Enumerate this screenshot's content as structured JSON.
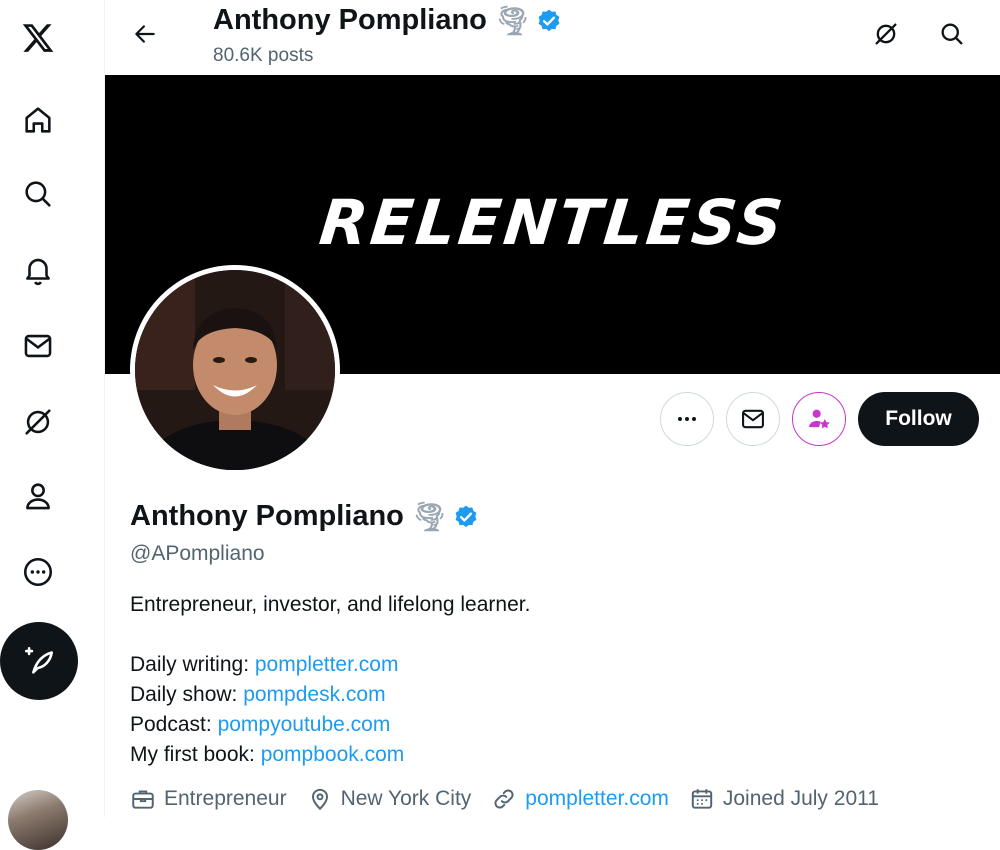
{
  "header": {
    "name": "Anthony Pompliano",
    "name_emoji": "🌪",
    "posts": "80.6K posts"
  },
  "banner": {
    "text": "RELENTLESS"
  },
  "profile": {
    "name": "Anthony Pompliano",
    "name_emoji": "🌪",
    "handle": "@APompliano",
    "bio_line1": "Entrepreneur, investor, and lifelong learner.",
    "bio_links": [
      {
        "label": "Daily writing: ",
        "url": "pompletter.com"
      },
      {
        "label": "Daily show: ",
        "url": "pompdesk.com"
      },
      {
        "label": "Podcast: ",
        "url": "pompyoutube.com"
      },
      {
        "label": "My first book: ",
        "url": "pompbook.com"
      }
    ],
    "meta": {
      "profession": "Entrepreneur",
      "location": "New York City",
      "website": "pompletter.com",
      "joined": "Joined July 2011"
    }
  },
  "actions": {
    "follow_label": "Follow"
  },
  "colors": {
    "accent": "#1d9bf0",
    "verified": "#1d9bf0",
    "subscribe": "#c936cc",
    "text": "#0f1419",
    "muted": "#536471"
  },
  "icons": {
    "logo": "x-logo-icon",
    "nav": [
      "home-icon",
      "search-icon",
      "bell-icon",
      "mail-icon",
      "grok-icon",
      "person-icon",
      "more-circle-icon"
    ],
    "compose": "compose-post-icon"
  }
}
